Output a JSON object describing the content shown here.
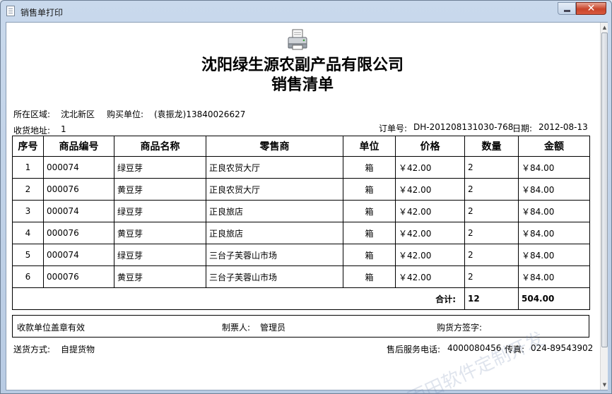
{
  "window": {
    "title": "销售单打印",
    "close_label": "✕"
  },
  "document": {
    "company": "沈阳绿生源农副产品有限公司",
    "title": "销售清单",
    "area_label": "所在区域:",
    "area_value": "沈北新区",
    "buyer_label": "购买单位:",
    "buyer_value": "(袁振龙)13840026627",
    "address_label": "收货地址:",
    "address_value": "1",
    "order_label": "订单号:",
    "order_value": "DH-201208131030-768",
    "date_label": "日期:",
    "date_value": "2012-08-13"
  },
  "table": {
    "headers": [
      "序号",
      "商品编号",
      "商品名称",
      "零售商",
      "单位",
      "价格",
      "数量",
      "金额"
    ],
    "rows": [
      [
        "1",
        "000074",
        "绿豆芽",
        "正良农贸大厅",
        "箱",
        "￥42.00",
        "2",
        "￥84.00"
      ],
      [
        "2",
        "000076",
        "黄豆芽",
        "正良农贸大厅",
        "箱",
        "￥42.00",
        "2",
        "￥84.00"
      ],
      [
        "3",
        "000074",
        "绿豆芽",
        "正良旅店",
        "箱",
        "￥42.00",
        "2",
        "￥84.00"
      ],
      [
        "4",
        "000076",
        "黄豆芽",
        "正良旅店",
        "箱",
        "￥42.00",
        "2",
        "￥84.00"
      ],
      [
        "5",
        "000074",
        "绿豆芽",
        "三台子芙蓉山市场",
        "箱",
        "￥42.00",
        "2",
        "￥84.00"
      ],
      [
        "6",
        "000076",
        "黄豆芽",
        "三台子芙蓉山市场",
        "箱",
        "￥42.00",
        "2",
        "￥84.00"
      ]
    ],
    "total_label": "合计:",
    "total_qty": "12",
    "total_amount": "504.00"
  },
  "footer": {
    "stamp_note": "收款单位盖章有效",
    "issuer_label": "制票人:",
    "issuer_value": "管理员",
    "buyer_sign_label": "购货方签字:",
    "delivery_label": "送货方式:",
    "delivery_value": "自提货物",
    "service_label": "售后服务电话:",
    "service_value": "4000080456",
    "fax_label": "传真:",
    "fax_value": "024-89543902"
  },
  "watermark": "雨田软件定制开发",
  "icons": [
    "document-icon",
    "minimize-icon",
    "close-icon",
    "printer-icon",
    "scroll-up-icon",
    "scroll-down-icon"
  ]
}
